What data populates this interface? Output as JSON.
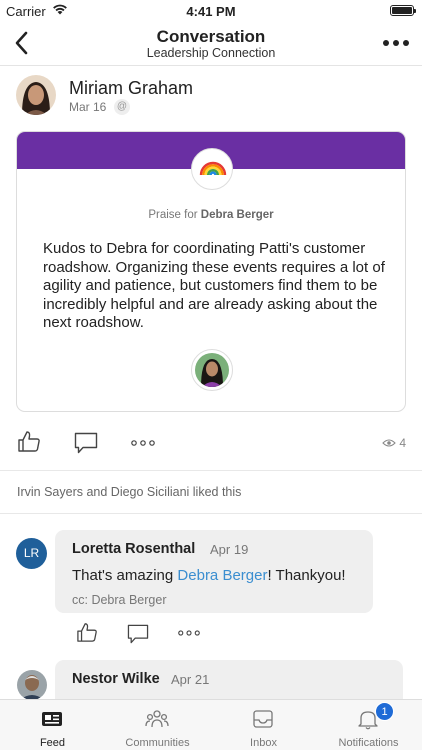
{
  "status_bar": {
    "carrier": "Carrier",
    "time": "4:41 PM",
    "battery_level": 1.0
  },
  "nav": {
    "title": "Conversation",
    "subtitle": "Leadership Connection",
    "back_icon": "chevron-left-icon",
    "more_icon": "more-horizontal-icon"
  },
  "post": {
    "author": "Miriam Graham",
    "date": "Mar 16",
    "mention_badge": "@",
    "praise": {
      "prefix": "Praise for",
      "recipient": "Debra Berger",
      "badge_icon": "rainbow-icon",
      "band_color": "#6a2fa3",
      "text": "Kudos to Debra for coordinating Patti's customer roadshow. Organizing these events requires a lot of agility and patience, but customers find them to be incredibly helpful and are already asking about the next roadshow."
    },
    "actions": {
      "like_icon": "thumbs-up-icon",
      "comment_icon": "comment-icon",
      "more_icon": "more-horizontal-icon",
      "views_icon": "eye-icon",
      "views_count": "4"
    },
    "likes_text": "Irvin Sayers and Diego Siciliani liked this"
  },
  "comments": [
    {
      "initials": "LR",
      "author": "Loretta  Rosenthal",
      "date": "Apr 19",
      "body_before": "That's amazing ",
      "mention": "Debra Berger",
      "body_after": "! Thankyou!",
      "cc": "cc: Debra Berger"
    },
    {
      "author": "Nestor Wilke",
      "date": "Apr 21"
    }
  ],
  "tabs": [
    {
      "label": "Feed",
      "icon": "feed-icon",
      "active": true
    },
    {
      "label": "Communities",
      "icon": "communities-icon",
      "active": false
    },
    {
      "label": "Inbox",
      "icon": "inbox-icon",
      "active": false
    },
    {
      "label": "Notifications",
      "icon": "bell-icon",
      "active": false,
      "badge": "1"
    }
  ],
  "colors": {
    "accent": "#1f6bd6",
    "mention": "#3b8ed0",
    "initials_bg": "#1f5f9a"
  }
}
